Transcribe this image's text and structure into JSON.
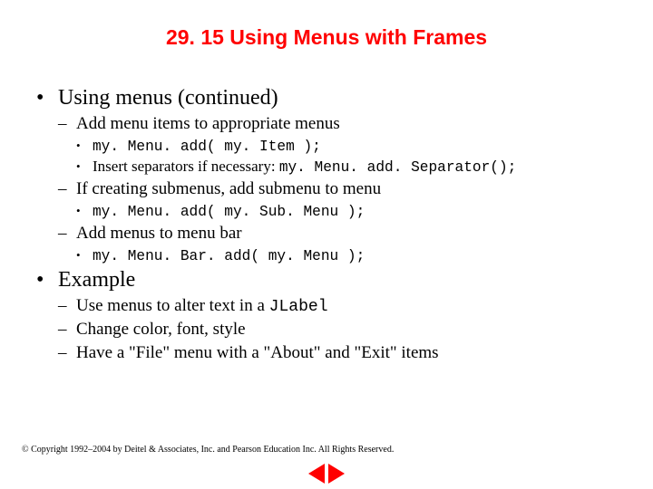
{
  "title": "29. 15  Using Menus with Frames",
  "bullets": {
    "item1": "Using menus (continued)",
    "item1_1": "Add menu items to appropriate menus",
    "item1_1_1": "my. Menu. add( my. Item );",
    "item1_1_2_prefix": "Insert separators if necessary: ",
    "item1_1_2_code": "my. Menu. add. Separator();",
    "item1_2": "If creating submenus, add submenu to menu",
    "item1_2_1": "my. Menu. add( my. Sub. Menu );",
    "item1_3": "Add menus to menu bar",
    "item1_3_1": "my. Menu. Bar. add( my. Menu );",
    "item2": "Example",
    "item2_1_prefix": "Use menus to alter text in a ",
    "item2_1_code": "JLabel",
    "item2_2": "Change color, font, style",
    "item2_3": "Have a \"File\" menu with a \"About\" and \"Exit\" items"
  },
  "copyright": "© Copyright 1992–2004 by Deitel & Associates, Inc. and Pearson Education Inc. All Rights Reserved."
}
